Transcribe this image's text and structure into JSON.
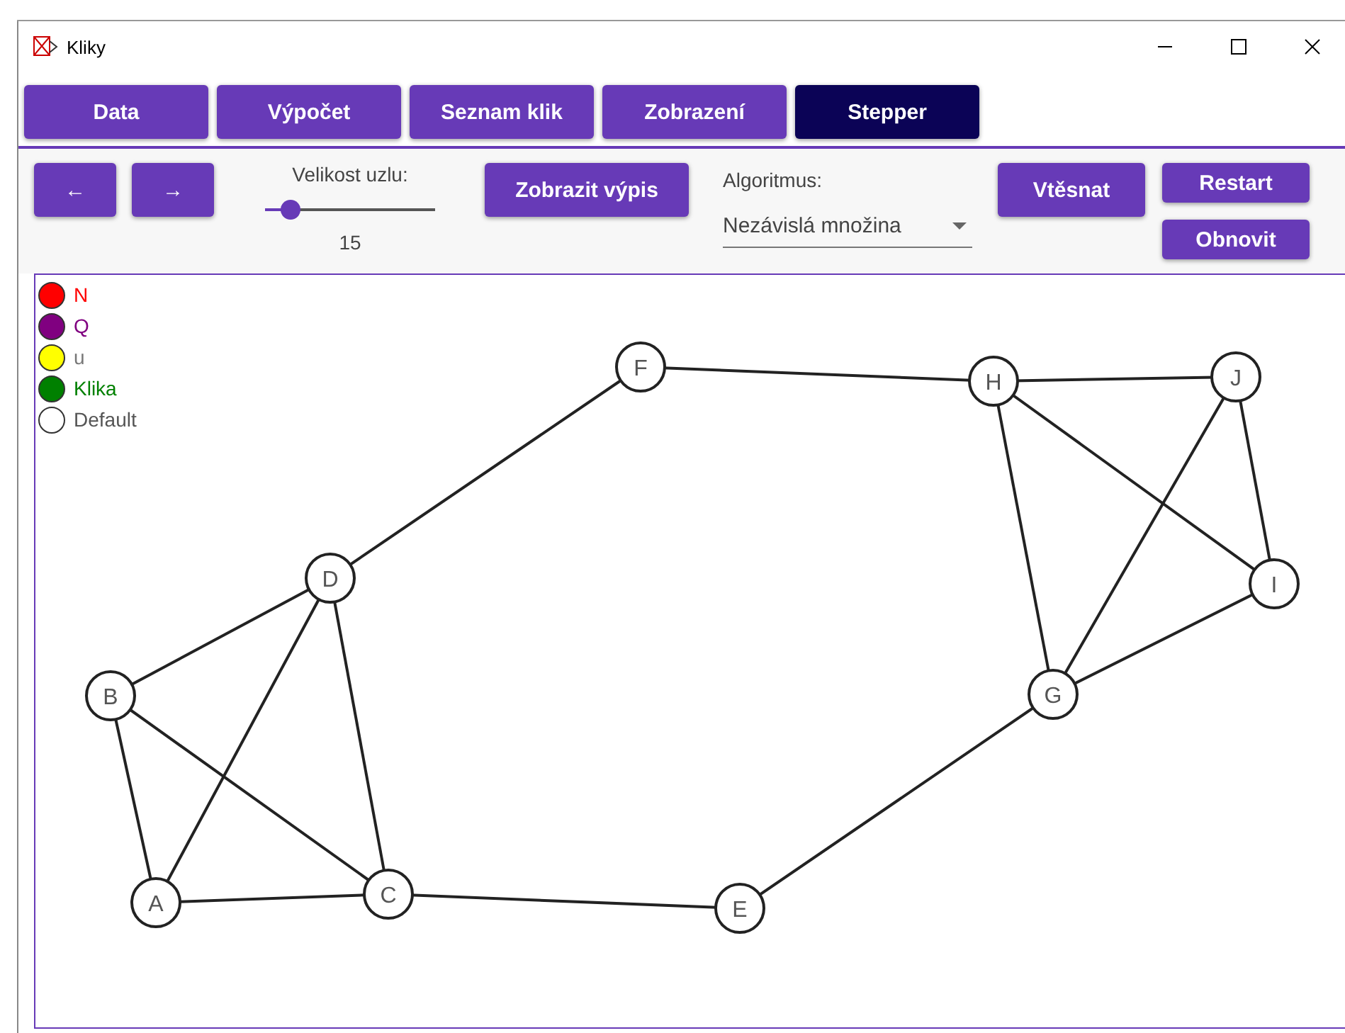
{
  "window": {
    "title": "Kliky"
  },
  "tabs": [
    {
      "label": "Data",
      "selected": false
    },
    {
      "label": "Výpočet",
      "selected": false
    },
    {
      "label": "Seznam klik",
      "selected": false
    },
    {
      "label": "Zobrazení",
      "selected": false
    },
    {
      "label": "Stepper",
      "selected": true
    }
  ],
  "toolbar": {
    "prev": "←",
    "next": "→",
    "node_size": {
      "label": "Velikost uzlu:",
      "level": 0.15,
      "reading": "15"
    },
    "show_log": "Zobrazit výpis",
    "algorithm": {
      "label": "Algoritmus:",
      "value": "Nezávislá množina"
    },
    "compress": "Vtěsnat",
    "restart": "Restart",
    "refresh": "Obnovit"
  },
  "legend": [
    {
      "label": "N",
      "color": "#ff0000"
    },
    {
      "label": "Q",
      "color": "#800080"
    },
    {
      "label": "u",
      "color": "#ffff00"
    },
    {
      "label": "Klika",
      "color": "#008000"
    },
    {
      "label": "Default",
      "color": "#ffffff"
    }
  ],
  "graph": {
    "nodes": [
      "F",
      "H",
      "J",
      "I",
      "D",
      "B",
      "G",
      "A",
      "C",
      "E"
    ]
  }
}
